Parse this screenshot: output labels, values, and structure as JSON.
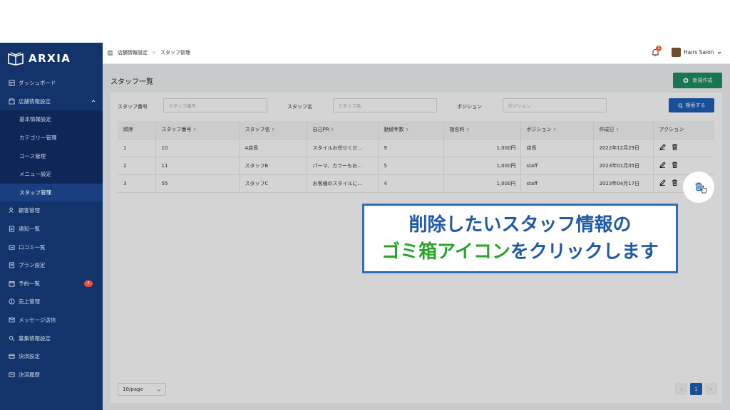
{
  "brand": {
    "name": "ARXIA"
  },
  "sidebar": {
    "items": [
      {
        "label": "ダッシュボード",
        "icon": "dashboard-icon"
      },
      {
        "label": "店舗情報設定",
        "icon": "store-icon",
        "expanded": true
      }
    ],
    "subitems": [
      {
        "label": "基本情報設定"
      },
      {
        "label": "カテゴリー管理"
      },
      {
        "label": "コース管理"
      },
      {
        "label": "メニュー設定"
      },
      {
        "label": "スタッフ管理",
        "active": true
      }
    ],
    "items_after": [
      {
        "label": "顧客管理",
        "icon": "users-icon"
      },
      {
        "label": "通知一覧",
        "icon": "notice-icon"
      },
      {
        "label": "口コミ一覧",
        "icon": "review-icon"
      },
      {
        "label": "プラン設定",
        "icon": "plan-icon"
      },
      {
        "label": "予約一覧",
        "icon": "calendar-icon",
        "badge": "3"
      },
      {
        "label": "売上管理",
        "icon": "sales-icon"
      },
      {
        "label": "メッセージ送信",
        "icon": "message-icon"
      },
      {
        "label": "募集情報設定",
        "icon": "recruit-icon"
      },
      {
        "label": "決済設定",
        "icon": "payment-icon"
      },
      {
        "label": "決済履歴",
        "icon": "history-icon"
      }
    ]
  },
  "header": {
    "breadcrumb": [
      "店舗情報設定",
      "スタッフ管理"
    ],
    "notification_count": "1",
    "user_name": "Hairs Salon"
  },
  "page": {
    "title": "スタッフ一覧",
    "new_button": "新規作成"
  },
  "filters": {
    "staff_no_label": "スタッフ番号",
    "staff_no_placeholder": "スタッフ番号",
    "staff_name_label": "スタッフ名",
    "staff_name_placeholder": "スタッフ名",
    "position_label": "ポジション",
    "position_placeholder": "ポジション",
    "search_button": "検索する"
  },
  "table": {
    "columns": [
      "順序",
      "スタッフ番号",
      "スタッフ名",
      "自己PR",
      "勤続年数",
      "指名料",
      "ポジション",
      "作成日",
      "アクション"
    ],
    "rows": [
      [
        "1",
        "10",
        "A店長",
        "スタイルお任せくだ…",
        "9",
        "1,000円",
        "店長",
        "2022年12月29日"
      ],
      [
        "2",
        "11",
        "スタッフB",
        "パーマ、カラーもお…",
        "5",
        "1,000円",
        "staff",
        "2023年01月05日"
      ],
      [
        "3",
        "55",
        "スタッフC",
        "お客様のスタイルに…",
        "4",
        "1,000円",
        "staff",
        "2023年04月17日"
      ]
    ]
  },
  "pagination": {
    "page_size": "10/page",
    "current_page": "1",
    "prev": "‹",
    "next": "›"
  },
  "callout": {
    "line1": "削除したいスタッフ情報の",
    "line2_highlight": "ゴミ箱アイコン",
    "line2_rest": "をクリックします"
  },
  "colors": {
    "sidebar": "#13336b",
    "primary": "#1e5fb8",
    "success": "#1f8f63",
    "callout_text": "#1f5aa8",
    "callout_highlight": "#2aa52a"
  }
}
